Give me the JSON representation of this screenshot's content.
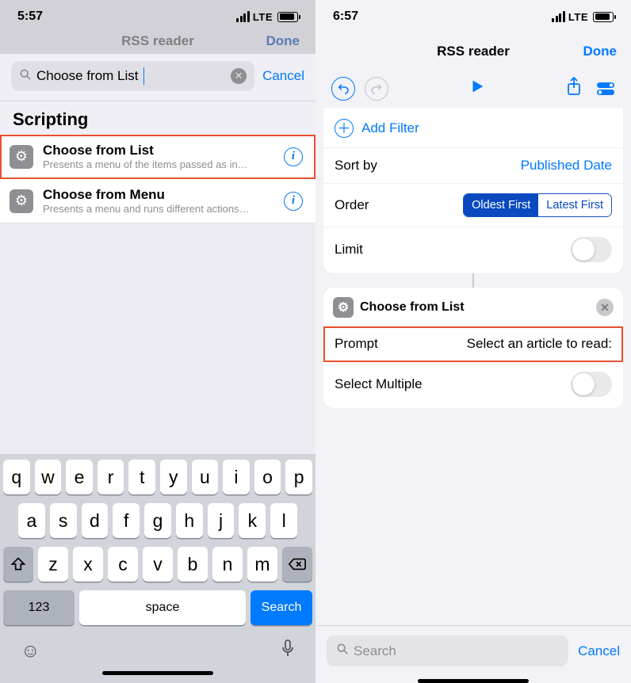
{
  "left": {
    "status": {
      "time": "5:57",
      "network": "LTE"
    },
    "dim_header": {
      "title": "RSS reader",
      "done": "Done"
    },
    "search": {
      "value": "Choose from List",
      "cancel": "Cancel"
    },
    "section_title": "Scripting",
    "results": [
      {
        "title": "Choose from List",
        "subtitle": "Presents a menu of the items passed as in…"
      },
      {
        "title": "Choose from Menu",
        "subtitle": "Presents a menu and runs different actions…"
      }
    ],
    "keyboard": {
      "row1": [
        "q",
        "w",
        "e",
        "r",
        "t",
        "y",
        "u",
        "i",
        "o",
        "p"
      ],
      "row2": [
        "a",
        "s",
        "d",
        "f",
        "g",
        "h",
        "j",
        "k",
        "l"
      ],
      "row3": [
        "z",
        "x",
        "c",
        "v",
        "b",
        "n",
        "m"
      ],
      "k123": "123",
      "space": "space",
      "search": "Search"
    }
  },
  "right": {
    "status": {
      "time": "6:57",
      "network": "LTE"
    },
    "nav": {
      "title": "RSS reader",
      "done": "Done"
    },
    "filter_card": {
      "add_filter": "Add Filter",
      "sort_label": "Sort by",
      "sort_value": "Published Date",
      "order_label": "Order",
      "order_options": [
        "Oldest First",
        "Latest First"
      ],
      "order_selected": 0,
      "limit_label": "Limit",
      "limit_on": false
    },
    "choose_card": {
      "header": "Choose from List",
      "prompt_label": "Prompt",
      "prompt_value": "Select an article to read:",
      "multi_label": "Select Multiple",
      "multi_on": false
    },
    "bottom": {
      "placeholder": "Search",
      "cancel": "Cancel"
    }
  }
}
